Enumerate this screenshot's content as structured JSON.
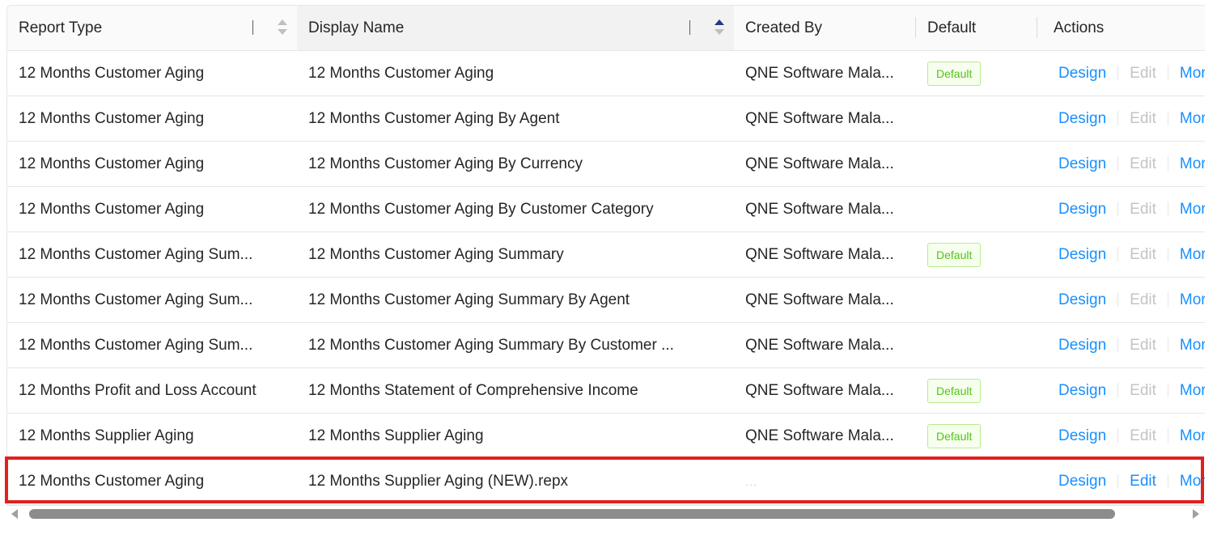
{
  "columns": {
    "report_type": "Report Type",
    "display_name": "Display Name",
    "created_by": "Created By",
    "default": "Default",
    "actions": "Actions"
  },
  "action_labels": {
    "design": "Design",
    "edit": "Edit",
    "more": "More"
  },
  "rows": [
    {
      "report_type": "12 Months Customer Aging",
      "display_name": "12 Months Customer Aging",
      "created_by": "QNE Software Mala...",
      "default": "Default",
      "edit_enabled": false
    },
    {
      "report_type": "12 Months Customer Aging",
      "display_name": "12 Months Customer Aging By Agent",
      "created_by": "QNE Software Mala...",
      "default": "",
      "edit_enabled": false
    },
    {
      "report_type": "12 Months Customer Aging",
      "display_name": "12 Months Customer Aging By Currency",
      "created_by": "QNE Software Mala...",
      "default": "",
      "edit_enabled": false
    },
    {
      "report_type": "12 Months Customer Aging",
      "display_name": "12 Months Customer Aging By Customer Category",
      "created_by": "QNE Software Mala...",
      "default": "",
      "edit_enabled": false
    },
    {
      "report_type": "12 Months Customer Aging Sum...",
      "display_name": "12 Months Customer Aging Summary",
      "created_by": "QNE Software Mala...",
      "default": "Default",
      "edit_enabled": false
    },
    {
      "report_type": "12 Months Customer Aging Sum...",
      "display_name": "12 Months Customer Aging Summary By Agent",
      "created_by": "QNE Software Mala...",
      "default": "",
      "edit_enabled": false
    },
    {
      "report_type": "12 Months Customer Aging Sum...",
      "display_name": "12 Months Customer Aging Summary By Customer ...",
      "created_by": "QNE Software Mala...",
      "default": "",
      "edit_enabled": false
    },
    {
      "report_type": "12 Months Profit and Loss Account",
      "display_name": "12 Months Statement of Comprehensive Income",
      "created_by": "QNE Software Mala...",
      "default": "Default",
      "edit_enabled": false
    },
    {
      "report_type": "12 Months Supplier Aging",
      "display_name": "12 Months Supplier Aging",
      "created_by": "QNE Software Mala...",
      "default": "Default",
      "edit_enabled": false
    },
    {
      "report_type": "12 Months Customer Aging",
      "display_name": "12 Months Supplier Aging (NEW).repx",
      "created_by": "...",
      "default": "",
      "edit_enabled": true
    }
  ],
  "sort": {
    "column": "display_name",
    "direction": "ascending"
  },
  "highlighted_row": 10
}
